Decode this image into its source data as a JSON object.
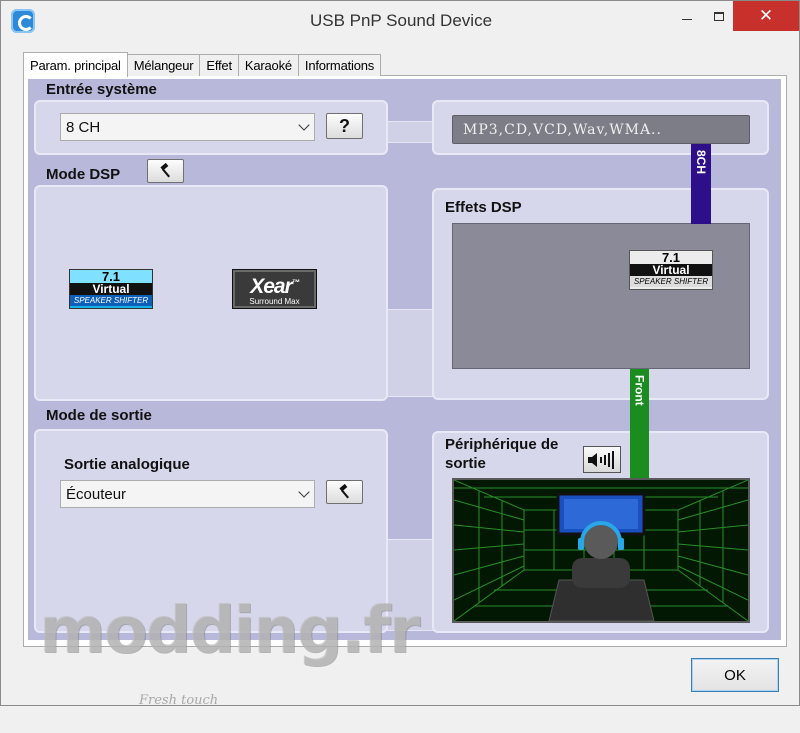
{
  "window": {
    "title": "USB PnP Sound Device",
    "close_glyph": "✕"
  },
  "tabs": [
    {
      "label": "Param. principal",
      "active": true
    },
    {
      "label": "Mélangeur",
      "active": false
    },
    {
      "label": "Effet",
      "active": false
    },
    {
      "label": "Karaoké",
      "active": false
    },
    {
      "label": "Informations",
      "active": false
    }
  ],
  "system_input": {
    "title": "Entrée système",
    "selected": "8 CH",
    "help_label": "?",
    "formats": "MP3,CD,VCD,Wav,WMA.."
  },
  "dsp_mode": {
    "title": "Mode DSP",
    "virtual_71": {
      "top": "7.1",
      "mid": "Virtual",
      "bottom": "SPEAKER SHIFTER"
    },
    "xear": {
      "brand": "Xear",
      "trademark": "™",
      "sub": "Surround Max"
    }
  },
  "dsp_effects": {
    "title": "Effets DSP",
    "channel_in": "8CH",
    "channel_out": "Front"
  },
  "output_mode": {
    "title": "Mode de sortie",
    "analog_label": "Sortie analogique",
    "selected": "Écouteur"
  },
  "output_device": {
    "title_line1": "Périphérique de",
    "title_line2": "sortie"
  },
  "footer": {
    "ok_label": "OK"
  },
  "watermark": {
    "text": "modding.fr",
    "tagline": "Fresh touch"
  },
  "colors": {
    "purple_area": "#b8b8da",
    "panel": "#d7d7ec",
    "bar_8ch": "#2e0f8a",
    "bar_front": "#1b8c1f",
    "close_button": "#c7302b"
  }
}
